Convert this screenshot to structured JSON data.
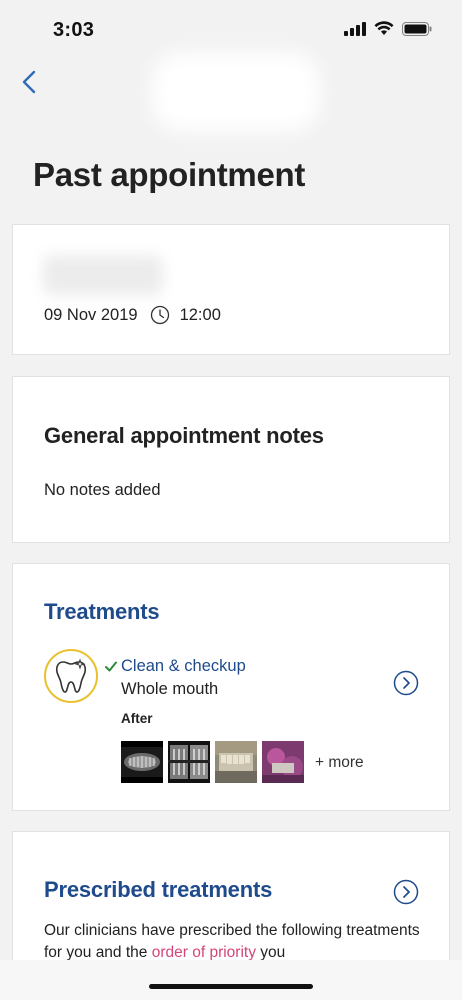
{
  "status_bar": {
    "time": "3:03"
  },
  "nav": {
    "back_icon": "chevron-left-icon"
  },
  "page": {
    "title": "Past appointment"
  },
  "appointment": {
    "date": "09 Nov 2019",
    "time": "12:00"
  },
  "notes": {
    "heading": "General appointment notes",
    "text": "No notes added"
  },
  "treatments": {
    "heading": "Treatments",
    "items": [
      {
        "name": "Clean & checkup",
        "area": "Whole mouth",
        "after_label": "After",
        "more_label": "+ more"
      }
    ]
  },
  "prescribed": {
    "heading": "Prescribed treatments",
    "body_start": "Our clinicians have prescribed the following treatments for you and the ",
    "link_text": "order of priority",
    "body_end": " you"
  },
  "colors": {
    "accent_blue": "#1f4b8c",
    "link_pink": "#d4457a",
    "badge_yellow": "#e9c030",
    "check_green": "#2e8b3a"
  }
}
